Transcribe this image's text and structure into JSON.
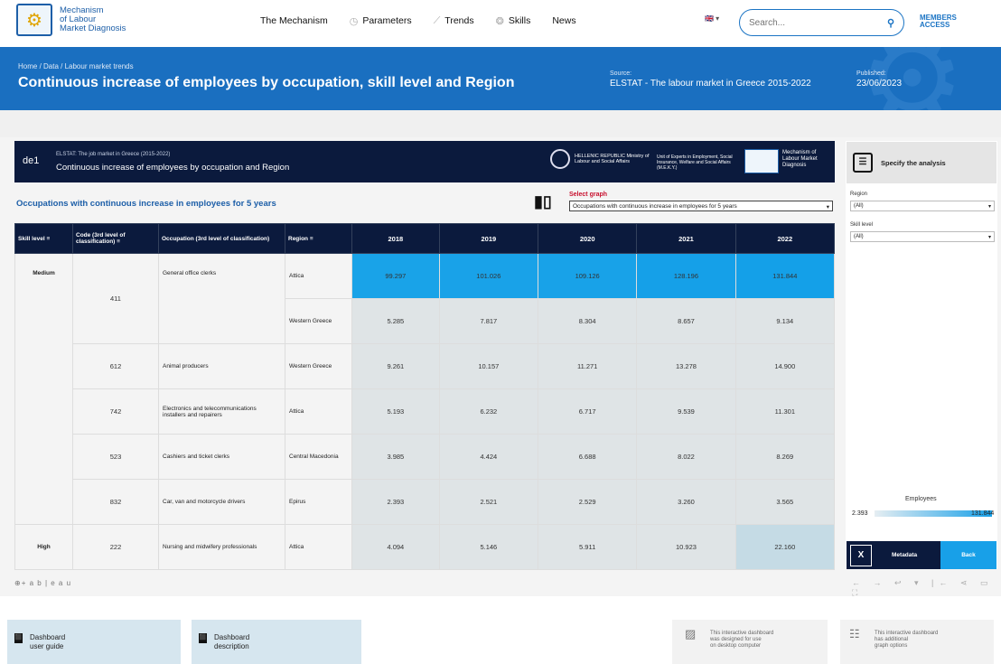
{
  "nav": {
    "logo_line1": "Mechanism",
    "logo_line2": "of Labour",
    "logo_line3": "Market Diagnosis",
    "items": [
      {
        "label": "The Mechanism",
        "icon": ""
      },
      {
        "label": "Parameters",
        "icon": "◷"
      },
      {
        "label": "Trends",
        "icon": "⟋"
      },
      {
        "label": "Skills",
        "icon": "❂"
      },
      {
        "label": "News",
        "icon": ""
      }
    ],
    "lang": "🇬🇧 ▾",
    "search_placeholder": "Search...",
    "members_line1": "MEMBERS",
    "members_line2": "ACCESS"
  },
  "hero": {
    "breadcrumb": "Home / Data / Labour market trends",
    "title": "Continuous increase of employees by occupation, skill level and Region",
    "source_label": "Source:",
    "source_value": "ELSTAT - The labour market in Greece 2015-2022",
    "published_label": "Published:",
    "published_value": "23/06/2023"
  },
  "dashboard": {
    "code": "de1",
    "subtitle_prefix": "ELSTAT:",
    "subtitle": "The job market in Greece (2015-2022)",
    "title": "Continuous increase of employees by occupation and Region",
    "ministry": "HELLENIC REPUBLIC Ministry of Labour and Social Affairs",
    "unit": "Unit of Experts in Employment, Social Insurance, Welfare and Social Affairs (M.E.K.Y.)",
    "mech": "Mechanism of Labour Market Diagnosis",
    "section_title": "Occupations with continuous increase in employees for 5 years",
    "select_graph_label": "Select graph",
    "select_graph_value": "Occupations with continuous increase in employees for 5 years"
  },
  "table": {
    "headers": {
      "skill": "Skill level",
      "code": "Code (3rd level of classification)",
      "occupation": "Occupation (3rd level of classification)",
      "region": "Region",
      "years": [
        "2018",
        "2019",
        "2020",
        "2021",
        "2022"
      ]
    },
    "rows": [
      {
        "skill": "Medium",
        "code": "411",
        "occupation": "General office clerks",
        "region": "Attica",
        "values": [
          "99.297",
          "101.026",
          "109.126",
          "128.196",
          "131.844"
        ]
      },
      {
        "skill": "",
        "code": "",
        "occupation": "",
        "region": "Western Greece",
        "values": [
          "5.285",
          "7.817",
          "8.304",
          "8.657",
          "9.134"
        ]
      },
      {
        "skill": "",
        "code": "612",
        "occupation": "Animal producers",
        "region": "Western Greece",
        "values": [
          "9.261",
          "10.157",
          "11.271",
          "13.278",
          "14.900"
        ]
      },
      {
        "skill": "",
        "code": "742",
        "occupation": "Electronics and telecommunications installers and repairers",
        "region": "Attica",
        "values": [
          "5.193",
          "6.232",
          "6.717",
          "9.539",
          "11.301"
        ]
      },
      {
        "skill": "",
        "code": "523",
        "occupation": "Cashiers and ticket clerks",
        "region": "Central Macedonia",
        "values": [
          "3.985",
          "4.424",
          "6.688",
          "8.022",
          "8.269"
        ]
      },
      {
        "skill": "",
        "code": "832",
        "occupation": "Car, van and motorcycle drivers",
        "region": "Epirus",
        "values": [
          "2.393",
          "2.521",
          "2.529",
          "3.260",
          "3.565"
        ]
      },
      {
        "skill": "High",
        "code": "222",
        "occupation": "Nursing and midwifery professionals",
        "region": "Attica",
        "values": [
          "4.094",
          "5.146",
          "5.911",
          "10.923",
          "22.160"
        ]
      }
    ]
  },
  "side": {
    "specify": "Specify the analysis",
    "region_label": "Region",
    "region_value": "(All)",
    "skill_label": "Skill level",
    "skill_value": "(All)",
    "legend_title": "Employees",
    "legend_min": "2.393",
    "legend_max": "131.844",
    "metadata": "Metadata",
    "back": "Back"
  },
  "footer": {
    "tableau": "⊕+ a b | e a u",
    "toolbar": "← → ↩ ▾ |← ⋖ ▭ ⛶",
    "guide_line1": "Dashboard",
    "guide_line2": "user guide",
    "desc_line1": "Dashboard",
    "desc_line2": "description",
    "desktop_line1": "This interactive dashboard",
    "desktop_line2": "was designed for use",
    "desktop_line3": "on desktop computer",
    "options_line1": "This interactive dashboard",
    "options_line2": "has additional",
    "options_line3": "graph options"
  },
  "colors": {
    "navy": "#0b1a3d",
    "blue": "#1a6fc0",
    "cyan": "#18a0e8",
    "cell": "#dfe4e6"
  }
}
